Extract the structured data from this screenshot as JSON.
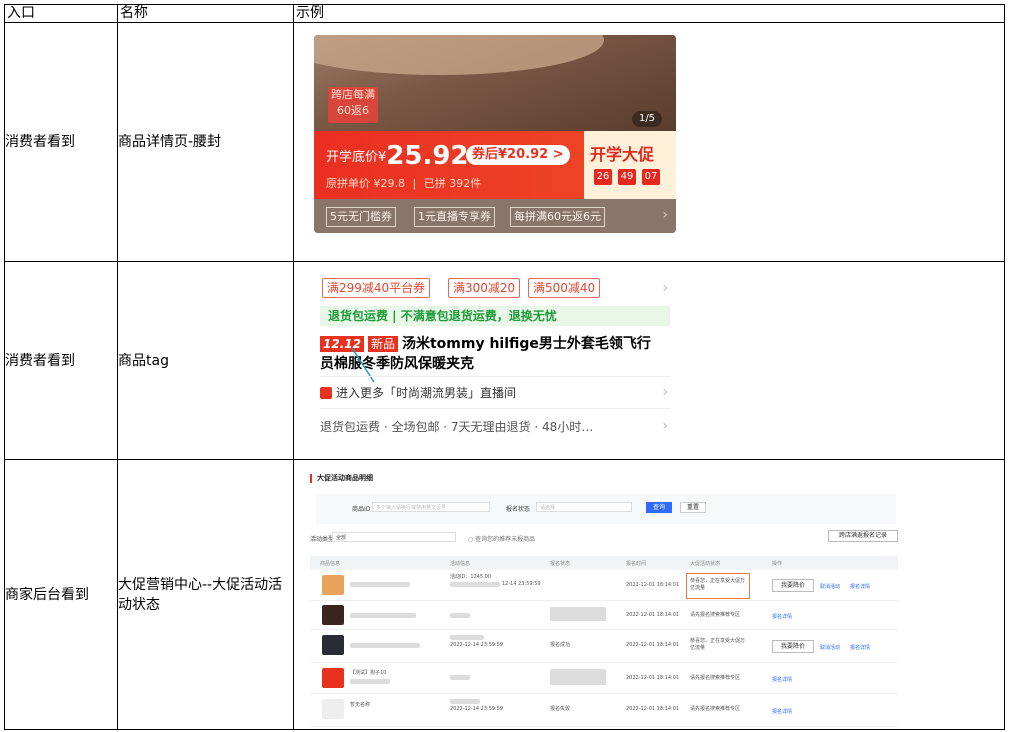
{
  "table": {
    "headers": [
      "入口",
      "名称",
      "示例"
    ],
    "rows": [
      {
        "entry": "消费者看到",
        "name": "商品详情页-腰封"
      },
      {
        "entry": "消费者看到",
        "name": "商品tag"
      },
      {
        "entry": "商家后台看到",
        "name": "大促营销中心--大促活动活动状态"
      }
    ]
  },
  "belt": {
    "tag": "跨店每满60返6",
    "pager": "1/5",
    "price_label": "开学底价¥",
    "price": "25.92",
    "coupon": "券后¥20.92 >",
    "original": "原拼单价 ¥29.8",
    "sold": "已拼 392件",
    "promo": "开学大促",
    "countdown": [
      "26",
      "49",
      "07"
    ],
    "chips": [
      "5元无门槛券",
      "1元直播专享券",
      "每拼满60元返6元"
    ]
  },
  "tags": {
    "coupons": [
      "满299减40平台券",
      "满300减20",
      "满500减40"
    ],
    "return_bar": "退货包运费 | 不满意包退货运费，退换无忧",
    "badge_1212": "12.12",
    "badge_new": "新品",
    "title_line1": "汤米tommy hilfige男士外套毛领飞行",
    "title_line2": "员棉服冬季防风保暖夹克",
    "live": "进入更多「时尚潮流男装」直播间",
    "services": "退货包运费 · 全场包邮 · 7天无理由退货 · 48小时…"
  },
  "backend": {
    "title": "大促活动商品明细",
    "product_id_label": "商品ID",
    "product_id_placeholder": "多个输入请换行或使用英文逗号",
    "signup_label": "报名状态",
    "signup_placeholder": "请选择",
    "query": "查询",
    "reset": "重置",
    "activity_type_label": "活动类型",
    "activity_type_value": "全部",
    "only_checkbox": "查询您的推荐未报商品",
    "records_button": "跨店满返报名记录",
    "columns": [
      "商品信息",
      "活动信息",
      "报名状态",
      "报名时间",
      "大促活动状态",
      "操作"
    ],
    "rows": [
      {
        "activity": "活动ID：1245.00",
        "activity_time": "12-14 23:59:59",
        "status": "",
        "signup_time": "2022-12-01 18:14:01",
        "promo_status": "恭喜您，正在享受大促万亿流量",
        "actions": [
          "我要降价",
          "取消活动",
          "报名详情"
        ]
      },
      {
        "activity": "",
        "activity_time": "",
        "status": "",
        "signup_time": "2022-12-01 18:14:01",
        "promo_status": "请先报名搜索推荐专区",
        "actions": [
          "报名详情"
        ]
      },
      {
        "activity": "",
        "activity_time": "2022-12-14 23:59:59",
        "status": "报名成功",
        "signup_time": "2022-12-01 18:14:01",
        "promo_status": "恭喜您，正在享受大促万亿流量",
        "actions": [
          "我要降价",
          "取消活动",
          "报名详情"
        ]
      },
      {
        "product": "【测试】狗子10",
        "activity": "",
        "activity_time": "",
        "status": "",
        "signup_time": "2022-12-01 18:14:01",
        "promo_status": "请先报名搜索推荐专区",
        "actions": [
          "报名详情"
        ]
      },
      {
        "product": "暂无名称",
        "activity": "",
        "activity_time": "2022-12-14 23:59:59",
        "status": "报名失败",
        "signup_time": "2022-12-01 18:14:01",
        "promo_status": "请先报名搜索推荐专区",
        "actions": [
          "报名详情"
        ]
      }
    ]
  }
}
